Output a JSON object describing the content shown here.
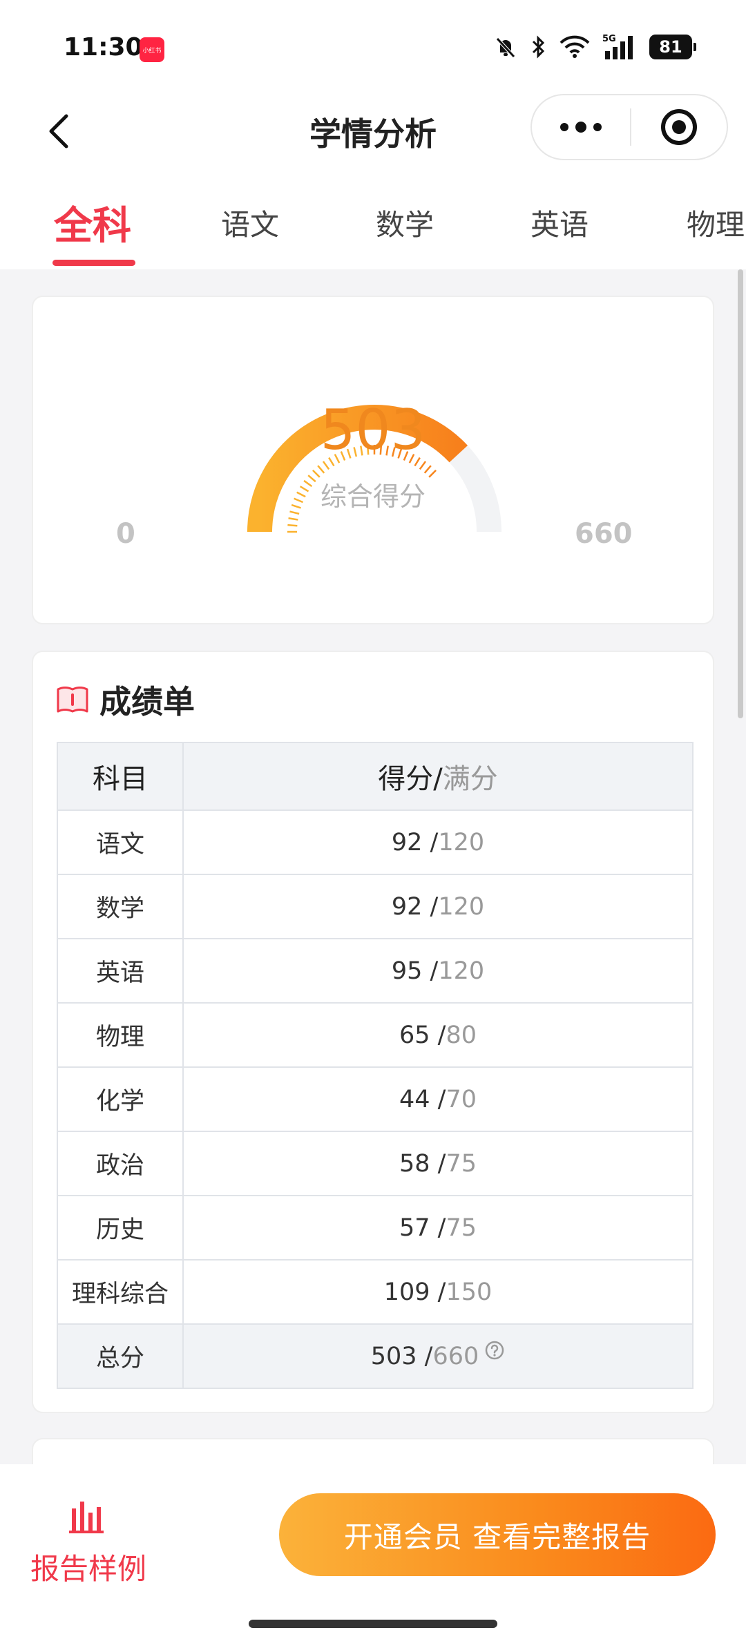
{
  "status_bar": {
    "time": "11:30",
    "app_badge": "小红书",
    "network": "5G",
    "battery": "81"
  },
  "nav": {
    "title": "学情分析",
    "back_icon": "chevron-left-icon",
    "more_icon": "more-dots-icon",
    "close_icon": "target-circle-icon"
  },
  "tabs": [
    {
      "label": "全科",
      "active": true
    },
    {
      "label": "语文",
      "active": false
    },
    {
      "label": "数学",
      "active": false
    },
    {
      "label": "英语",
      "active": false
    },
    {
      "label": "物理",
      "active": false
    }
  ],
  "overview": {
    "score": "503",
    "score_label": "综合得分",
    "min": "0",
    "max": "660",
    "accent_color": "#f0881e"
  },
  "transcript": {
    "title": "成绩单",
    "header_subject": "科目",
    "header_score": "得分",
    "header_full": "满分",
    "rows": [
      {
        "subject": "语文",
        "score": "92",
        "full": "120"
      },
      {
        "subject": "数学",
        "score": "92",
        "full": "120"
      },
      {
        "subject": "英语",
        "score": "95",
        "full": "120"
      },
      {
        "subject": "物理",
        "score": "65",
        "full": "80"
      },
      {
        "subject": "化学",
        "score": "44",
        "full": "70"
      },
      {
        "subject": "政治",
        "score": "58",
        "full": "75"
      },
      {
        "subject": "历史",
        "score": "57",
        "full": "75"
      },
      {
        "subject": "理科综合",
        "score": "109",
        "full": "150"
      }
    ],
    "total": {
      "subject": "总分",
      "score": "503",
      "full": "660"
    }
  },
  "bottom": {
    "sample_label": "报告样例",
    "cta_label": "开通会员 查看完整报告",
    "brand_color": "#f0394a"
  }
}
